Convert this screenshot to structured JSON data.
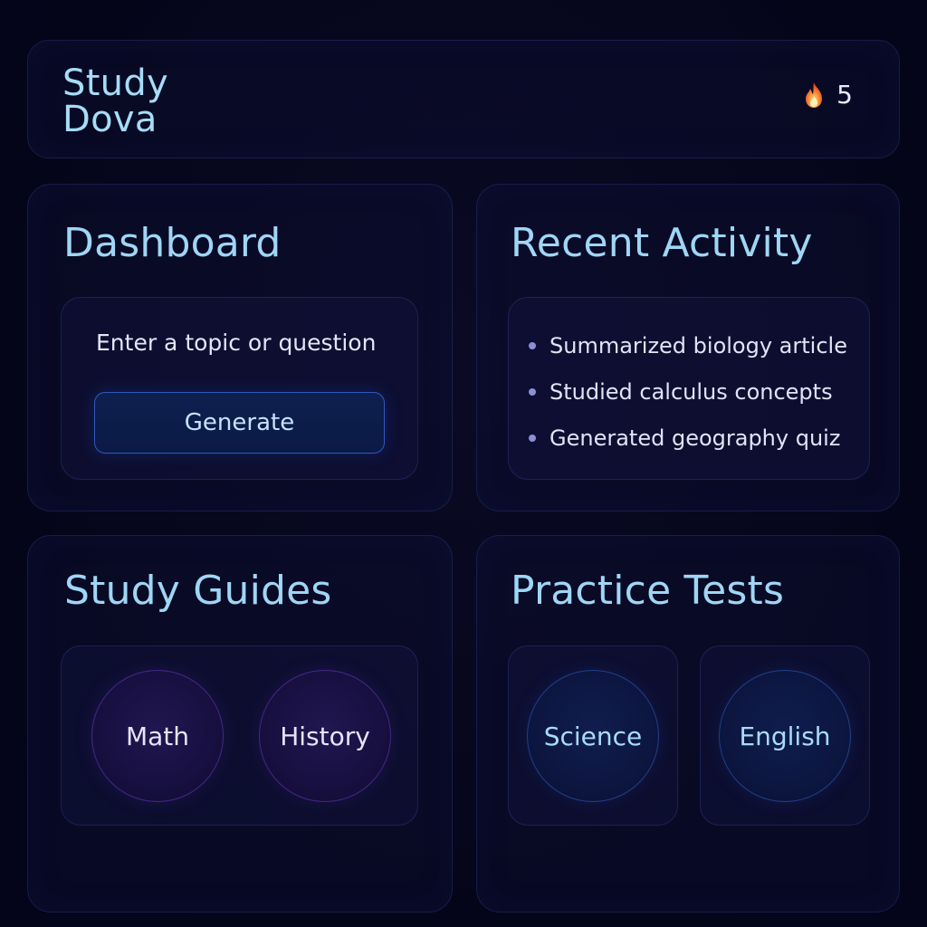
{
  "header": {
    "brand_line1": "Study",
    "brand_line2": "Dova",
    "streak_icon": "flame-icon",
    "streak_count": "5"
  },
  "dashboard": {
    "title": "Dashboard",
    "input_placeholder": "Enter a topic or question",
    "generate_label": "Generate"
  },
  "recent_activity": {
    "title": "Recent Activity",
    "items": [
      {
        "label": "Summarized biology article"
      },
      {
        "label": "Studied calculus concepts"
      },
      {
        "label": "Generated geography quiz"
      }
    ]
  },
  "study_guides": {
    "title": "Study Guides",
    "items": [
      {
        "label": "Math"
      },
      {
        "label": "History"
      }
    ]
  },
  "practice_tests": {
    "title": "Practice Tests",
    "items": [
      {
        "label": "Science"
      },
      {
        "label": "English"
      }
    ]
  },
  "colors": {
    "background": "#06061a",
    "heading": "#9fd6f5",
    "accent_blue": "#3c6ee6",
    "accent_purple": "#6e3cc8",
    "flame": "#f06a2a"
  }
}
